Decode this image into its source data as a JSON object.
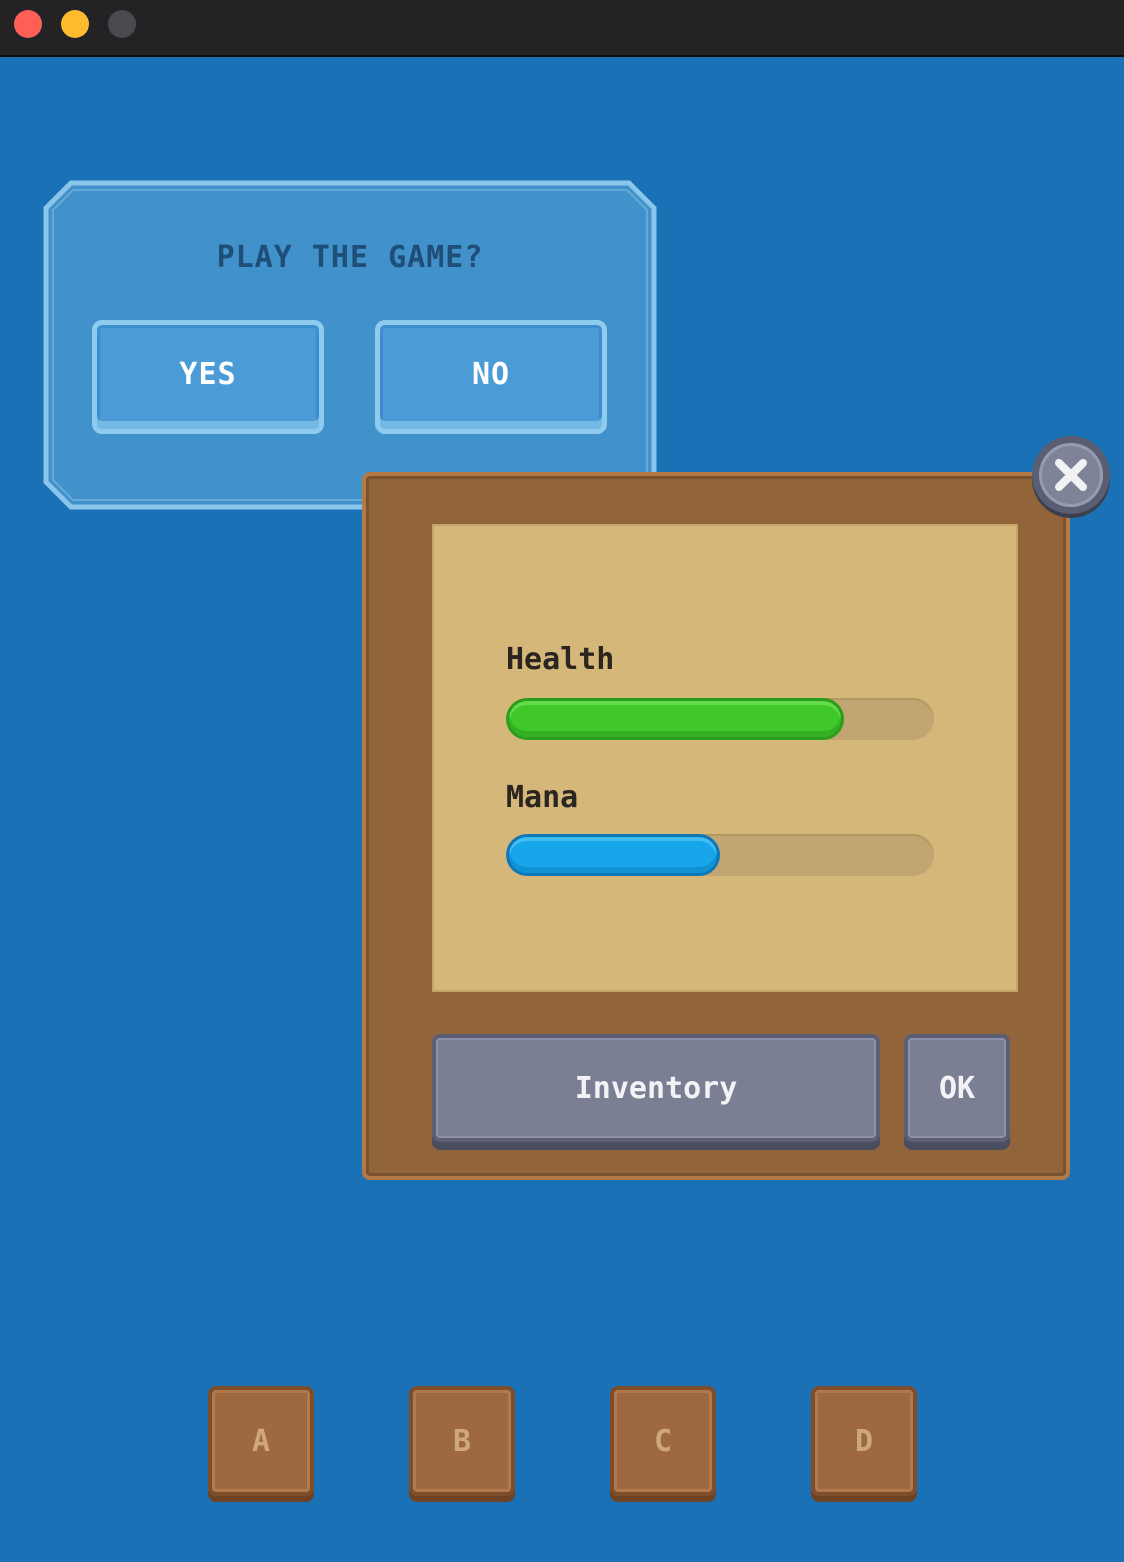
{
  "window": {
    "controls": [
      "close",
      "minimize",
      "zoom"
    ]
  },
  "dialog": {
    "title": "PLAY THE GAME?",
    "yes_label": "YES",
    "no_label": "NO"
  },
  "panel": {
    "health_label": "Health",
    "health_fraction": 0.79,
    "mana_label": "Mana",
    "mana_fraction": 0.5,
    "inventory_label": "Inventory",
    "ok_label": "OK",
    "close_icon": "close-x-icon"
  },
  "tiles": [
    "A",
    "B",
    "C",
    "D"
  ],
  "colors": {
    "background": "#1b71b5",
    "health": "#40c82a",
    "mana": "#17a6ea",
    "wood": "#92643a",
    "parchment": "#d5b879"
  }
}
